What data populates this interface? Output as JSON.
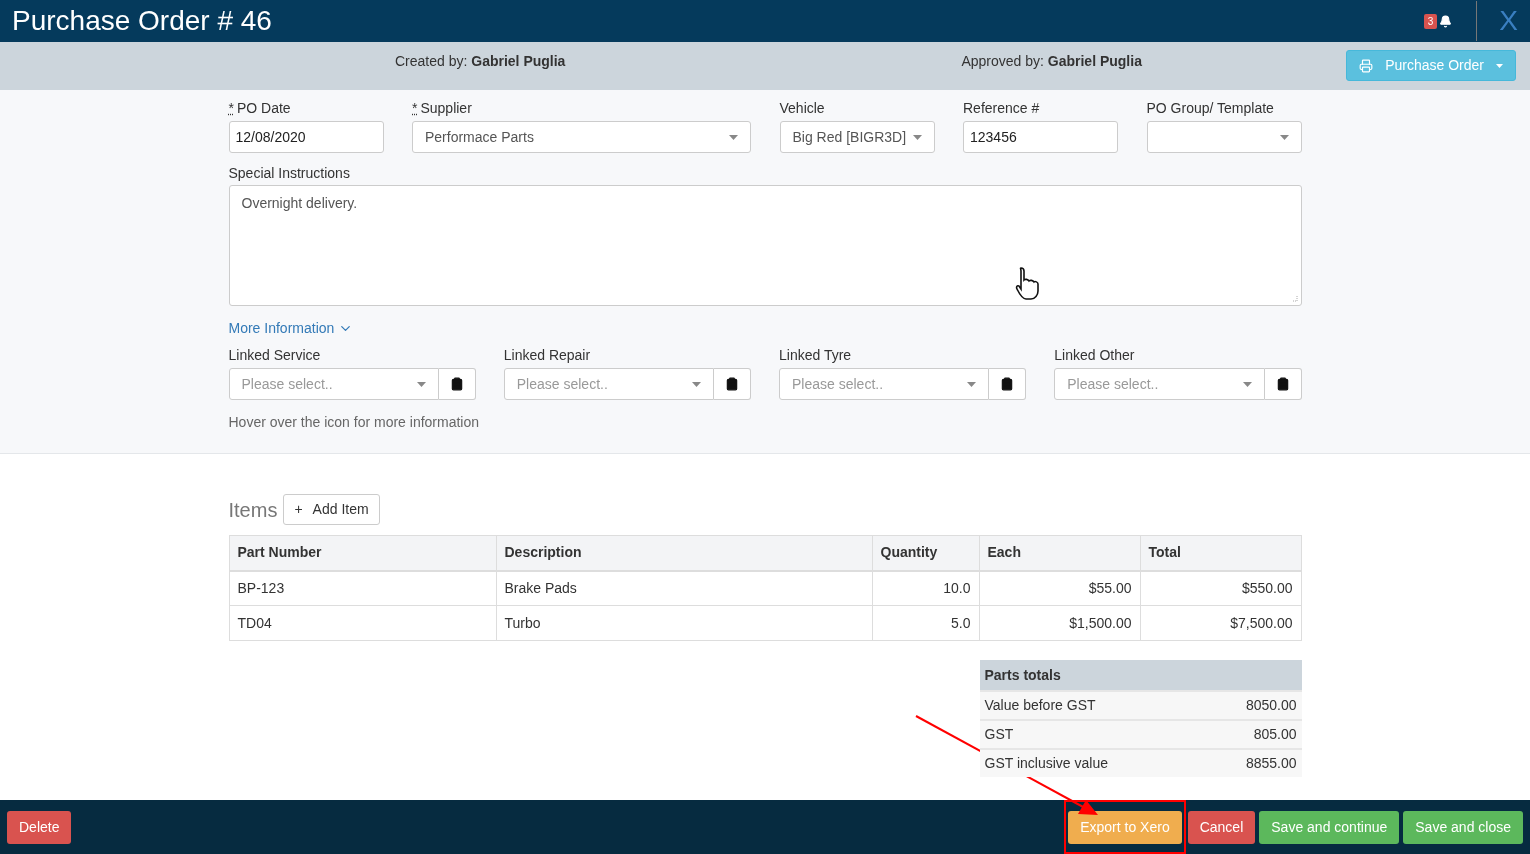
{
  "header": {
    "title": "Purchase Order # 46",
    "notification_count": "3",
    "close": "X"
  },
  "subheader": {
    "created_label": "Created by:",
    "created_by": "Gabriel Puglia",
    "approved_label": "Approved by:",
    "approved_by": "Gabriel Puglia",
    "print_button": "Purchase Order"
  },
  "fields": [
    {
      "kind": "input",
      "label": "PO Date",
      "required_mark": "*",
      "value": "12/08/2020"
    },
    {
      "kind": "select",
      "label": "Supplier",
      "required_mark": "*",
      "value": "Performace Parts"
    },
    {
      "kind": "select",
      "label": "Vehicle",
      "value": "Big Red [BIGR3D]"
    },
    {
      "kind": "input",
      "label": "Reference #",
      "value": "123456"
    },
    {
      "kind": "select",
      "label": "PO Group/ Template"
    }
  ],
  "special_instructions": {
    "label": "Special Instructions",
    "value": "Overnight delivery."
  },
  "more_information": {
    "label": "More Information",
    "expanded": true
  },
  "linked": [
    {
      "label": "Linked Service",
      "placeholder": "Please select.."
    },
    {
      "label": "Linked Repair",
      "placeholder": "Please select.."
    },
    {
      "label": "Linked Tyre",
      "placeholder": "Please select.."
    },
    {
      "label": "Linked Other",
      "placeholder": "Please select.."
    }
  ],
  "hint": "Hover over the icon for more information",
  "items": {
    "title": "Items",
    "add_button": "Add Item",
    "add_symbol": "+",
    "columns": [
      "Part Number",
      "Description",
      "Quantity",
      "Each",
      "Total"
    ],
    "rows": [
      [
        "BP-123",
        "Brake Pads",
        "10.0",
        "$55.00",
        "$550.00"
      ],
      [
        "TD04",
        "Turbo",
        "5.0",
        "$1,500.00",
        "$7,500.00"
      ]
    ]
  },
  "totals": {
    "title": "Parts totals",
    "rows": [
      {
        "label": "Value before GST",
        "value": "8050.00"
      },
      {
        "label": "GST",
        "value": "805.00"
      },
      {
        "label": "GST inclusive value",
        "value": "8855.00"
      }
    ]
  },
  "footer": {
    "left": [
      {
        "kind": "danger",
        "label": "Delete"
      }
    ],
    "right": [
      {
        "kind": "warning",
        "label": "Export to Xero",
        "highlighted": true
      },
      {
        "kind": "danger",
        "label": "Cancel"
      },
      {
        "kind": "success",
        "label": "Save and continue"
      },
      {
        "kind": "success",
        "label": "Save and close"
      }
    ]
  }
}
